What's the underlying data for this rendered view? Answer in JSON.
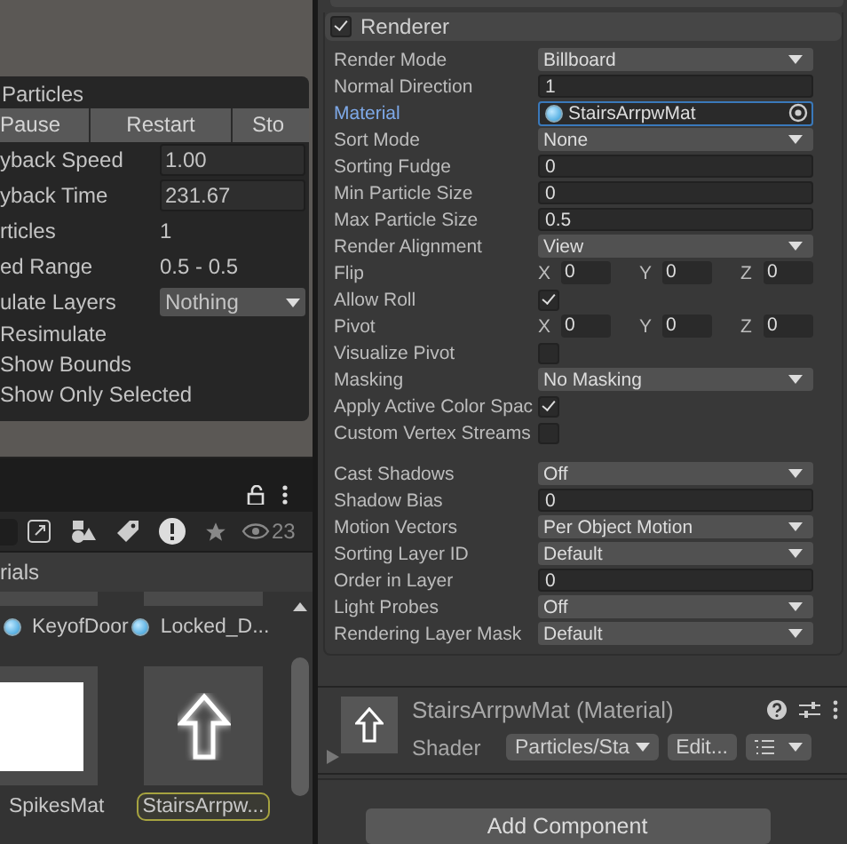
{
  "particle_effect": {
    "title": "Particles",
    "buttons": [
      "Pause",
      "Restart",
      "Sto"
    ],
    "rows": [
      {
        "label": "yback Speed",
        "kind": "field",
        "value": "1.00"
      },
      {
        "label": "yback Time",
        "kind": "field",
        "value": "231.67"
      },
      {
        "label": "rticles",
        "kind": "text",
        "value": "1"
      },
      {
        "label": "ed Range",
        "kind": "text",
        "value": "0.5 - 0.5"
      },
      {
        "label": "ulate Layers",
        "kind": "dropdown",
        "value": "Nothing"
      }
    ],
    "toggles": [
      "Resimulate",
      "Show Bounds",
      "Show Only Selected"
    ]
  },
  "project": {
    "hidden_count": "23",
    "breadcrumb": "rials",
    "assets": [
      {
        "name": "KeyofDoor",
        "kind": "sliver",
        "selected": false
      },
      {
        "name": "Locked_D...",
        "kind": "sliver",
        "selected": false
      },
      {
        "name": "SpikesMat",
        "kind": "white",
        "selected": false
      },
      {
        "name": "StairsArrpw...",
        "kind": "arrow",
        "selected": true
      }
    ]
  },
  "inspector": {
    "renderer": {
      "title": "Renderer",
      "enabled": true,
      "rows": [
        {
          "label": "Render Mode",
          "kind": "dropdown",
          "value": "Billboard"
        },
        {
          "label": "Normal Direction",
          "kind": "field",
          "value": "1"
        },
        {
          "label": "Material",
          "kind": "object",
          "value": "StairsArrpwMat",
          "focused": true
        },
        {
          "label": "Sort Mode",
          "kind": "dropdown",
          "value": "None"
        },
        {
          "label": "Sorting Fudge",
          "kind": "field",
          "value": "0"
        },
        {
          "label": "Min Particle Size",
          "kind": "field",
          "value": "0"
        },
        {
          "label": "Max Particle Size",
          "kind": "field",
          "value": "0.5"
        },
        {
          "label": "Render Alignment",
          "kind": "dropdown",
          "value": "View"
        },
        {
          "label": "Flip",
          "kind": "xyz",
          "axes": [
            "X",
            "Y",
            "Z"
          ],
          "values": [
            "0",
            "0",
            "0"
          ]
        },
        {
          "label": "Allow Roll",
          "kind": "checkbox",
          "checked": true
        },
        {
          "label": "Pivot",
          "kind": "xyz",
          "axes": [
            "X",
            "Y",
            "Z"
          ],
          "values": [
            "0",
            "0",
            "0"
          ]
        },
        {
          "label": "Visualize Pivot",
          "kind": "checkbox",
          "checked": false
        },
        {
          "label": "Masking",
          "kind": "dropdown",
          "value": "No Masking"
        },
        {
          "label": "Apply Active Color Spac",
          "kind": "checkbox",
          "checked": true
        },
        {
          "label": "Custom Vertex Streams",
          "kind": "checkbox",
          "checked": false
        },
        {
          "kind": "gap"
        },
        {
          "label": "Cast Shadows",
          "kind": "dropdown",
          "value": "Off"
        },
        {
          "label": "Shadow Bias",
          "kind": "field",
          "value": "0"
        },
        {
          "label": "Motion Vectors",
          "kind": "dropdown",
          "value": "Per Object Motion"
        },
        {
          "label": "Sorting Layer ID",
          "kind": "dropdown",
          "value": "Default"
        },
        {
          "label": "Order in Layer",
          "kind": "field",
          "value": "0"
        },
        {
          "label": "Light Probes",
          "kind": "dropdown",
          "value": "Off"
        },
        {
          "label": "Rendering Layer Mask",
          "kind": "dropdown",
          "value": "Default"
        }
      ]
    },
    "material": {
      "title": "StairsArrpwMat (Material)",
      "shader_label": "Shader",
      "shader": "Particles/Sta",
      "edit_button": "Edit..."
    },
    "add_component": "Add Component"
  }
}
